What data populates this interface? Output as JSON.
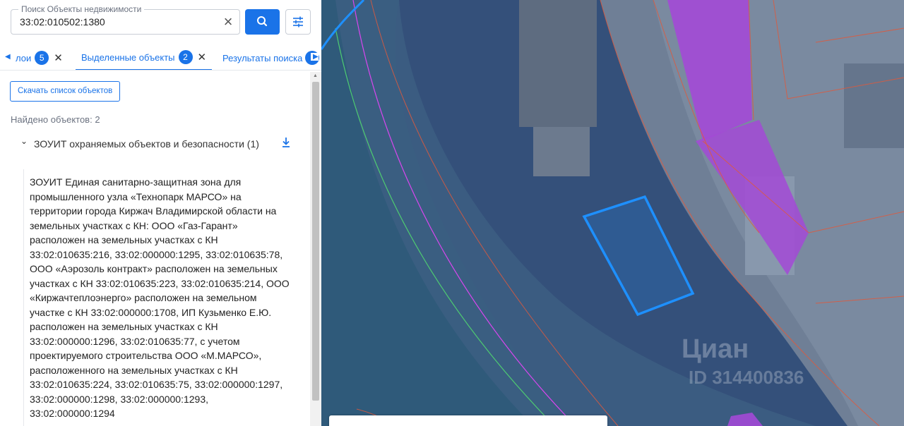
{
  "search": {
    "label": "Поиск Объекты недвижимости",
    "value": "33:02:010502:1380"
  },
  "tabs": [
    {
      "label": "лои",
      "count": "5"
    },
    {
      "label": "Выделенные объекты",
      "count": "2"
    },
    {
      "label": "Результаты поиска"
    }
  ],
  "results": {
    "download_label": "Скачать список объектов",
    "found_text": "Найдено объектов: 2",
    "group_title": "ЗОУИТ охраняемых объектов и безопасности (1)",
    "description": "ЗОУИТ Единая санитарно-защитная зона для промышленного узла «Технопарк МАРСО» на территории города Киржач Владимирской области на земельных участках с КН: ООО «Газ-Гарант» расположен на земельных участках с КН 33:02:010635:216, 33:02:000000:1295, 33:02:010635:78, ООО «Аэрозоль контракт» расположен на земельных участках с КН 33:02:010635:223, 33:02:010635:214, ООО «Киржачтеплоэнерго» расположен на земельном участке с КН 33:02:000000:1708, ИП Кузьменко Е.Ю. расположен на земельных участках с КН 33:02:000000:1296, 33:02:010635:77, с учетом проектируемого строительства ООО «М.МАРСО», расположенного на земельных участках с КН 33:02:010635:224, 33:02:010635:75, 33:02:000000:1297, 33:02:000000:1298, 33:02:000000:1293, 33:02:000000:1294"
  },
  "map": {
    "watermark": "Циан",
    "watermark_id": "ID 314400836"
  },
  "colors": {
    "accent": "#1a73e8",
    "zone_purple": "#9b3fd4",
    "selection_blue": "#1e90ff"
  }
}
